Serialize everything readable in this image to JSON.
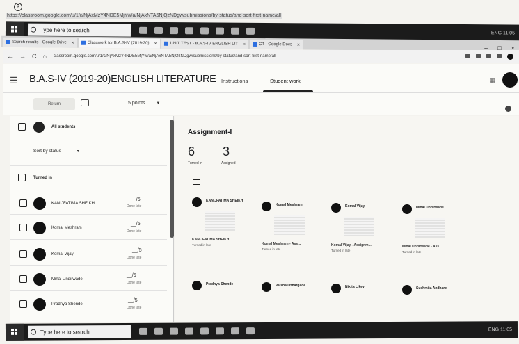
{
  "url_strip": {
    "text": "https://classroom.google.com/u/1/c/NjAxMzY4NDE5MjYw/a/NjAxNTA5NjQzNDgw/submissions/by-status/and-sort-first-name/all"
  },
  "taskbar": {
    "search_placeholder": "Type here to search",
    "tray_text": "ENG 11:05"
  },
  "browser_tabs": [
    {
      "label": "Search results - Google Drive"
    },
    {
      "label": "Classwork for B.A.S-IV (2019-20)"
    },
    {
      "label": "UNIT TEST - B.A.S-IV ENGLISH LIT"
    },
    {
      "label": "CT - Google Docs"
    }
  ],
  "address": {
    "url": "classroom.google.com/u/1/c/NjAxMzY4NDE5MjYw/a/NjAxNTA5NjQzNDgw/submissions/by-status/and-sort-first-name/all"
  },
  "header": {
    "class_title": "B.A.S-IV (2019-20)ENGLISH LITERATURE",
    "tab_instructions": "Instructions",
    "tab_student_work": "Student work"
  },
  "toolbar": {
    "return_label": "Return",
    "points_label": "5 points"
  },
  "left_panel": {
    "all_students": "All students",
    "sort_by": "Sort by status",
    "turned_in_section": "Turned in",
    "students": [
      {
        "name": "KANIJFATIMA SHEIKH",
        "grade": "__/5",
        "status": "Done late"
      },
      {
        "name": "Komal Meshram",
        "grade": "__/5",
        "status": "Done late"
      },
      {
        "name": "Komal Vijay",
        "grade": "__/5",
        "status": "Done late"
      },
      {
        "name": "Minal Undirwade",
        "grade": "__/5",
        "status": "Done late"
      },
      {
        "name": "Pradnya Shende",
        "grade": "__/5",
        "status": "Done late"
      }
    ]
  },
  "main": {
    "assignment_title": "Assignment-I",
    "turned_in_count": "6",
    "turned_in_label": "Turned in",
    "assigned_count": "3",
    "assigned_label": "Assigned",
    "cards": [
      {
        "name": "KANIJFATIMA SHEIKH",
        "file": "KANIJFATIMA SHEIKH...",
        "status": "Turned in late"
      },
      {
        "name": "Komal Meshram",
        "file": "Komal Meshram - Ass...",
        "status": "Turned in late"
      },
      {
        "name": "Komal Vijay",
        "file": "Komal Vijay - Assignm...",
        "status": "Turned in late"
      },
      {
        "name": "Minal Undirwade",
        "file": "Minal Undirwade - Ass...",
        "status": "Turned in late"
      }
    ],
    "cards_row2": [
      {
        "name": "Pradnya Shende"
      },
      {
        "name": "Vaishali Bhargade"
      },
      {
        "name": "Nikita Likey"
      },
      {
        "name": "Sushmita Andhare"
      }
    ]
  }
}
